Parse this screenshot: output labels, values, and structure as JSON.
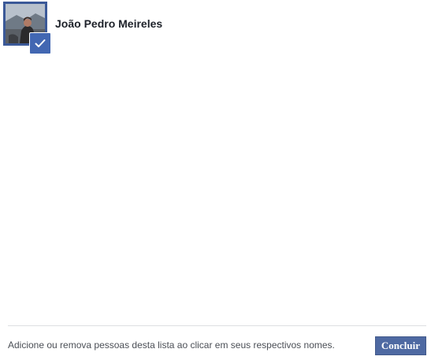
{
  "friend": {
    "name": "João Pedro Meireles",
    "selected": true,
    "avatar_icon": "profile-photo",
    "check_icon": "checkmark-icon"
  },
  "footer": {
    "hint": "Adicione ou remova pessoas desta lista ao clicar em seus respectivos nomes.",
    "done_label": "Concluir"
  },
  "colors": {
    "accent": "#3b5998",
    "button": "#4e69a2",
    "divider": "#dddfe2"
  }
}
